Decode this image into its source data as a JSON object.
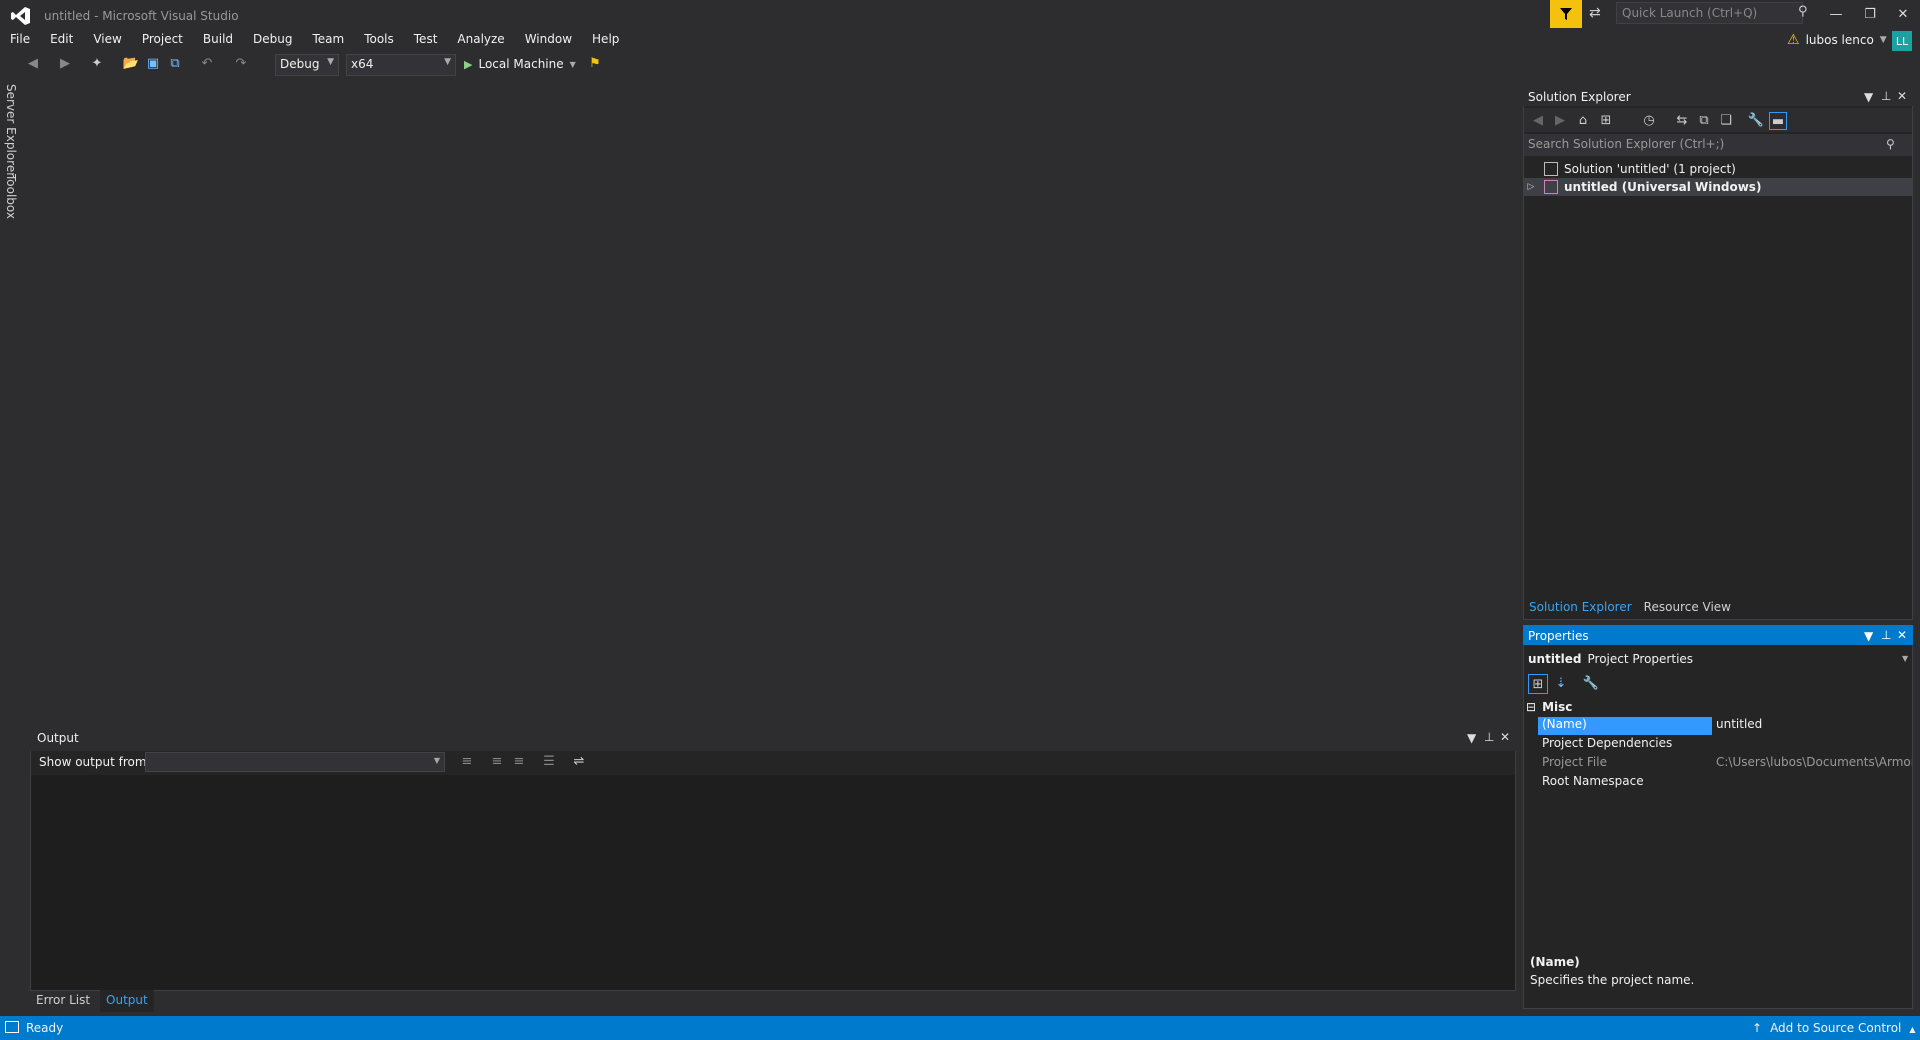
{
  "app": {
    "title": "untitled - Microsoft Visual Studio"
  },
  "quick_launch": {
    "placeholder": "Quick Launch (Ctrl+Q)"
  },
  "account": {
    "name": "lubos lenco",
    "initials": "LL"
  },
  "menu": [
    "File",
    "Edit",
    "View",
    "Project",
    "Build",
    "Debug",
    "Team",
    "Tools",
    "Test",
    "Analyze",
    "Window",
    "Help"
  ],
  "toolbar": {
    "configuration": "Debug",
    "platform": "x64",
    "run_target": "Local Machine"
  },
  "left_rail": {
    "server_explorer": "Server Explorer",
    "toolbox": "Toolbox"
  },
  "output": {
    "title": "Output",
    "show_output_from": "Show output from:",
    "tabs": [
      "Error List",
      "Output"
    ]
  },
  "solution_explorer": {
    "title": "Solution Explorer",
    "search_placeholder": "Search Solution Explorer (Ctrl+;)",
    "solution_label": "Solution 'untitled' (1 project)",
    "project_label": "untitled (Universal Windows)",
    "tabs": [
      "Solution Explorer",
      "Resource View"
    ]
  },
  "properties": {
    "title": "Properties",
    "object_name": "untitled",
    "object_type": "Project Properties",
    "category": "Misc",
    "rows": [
      {
        "name": "(Name)",
        "value": "untitled"
      },
      {
        "name": "Project Dependencies",
        "value": ""
      },
      {
        "name": "Project File",
        "value": "C:\\Users\\lubos\\Documents\\Armory\\"
      },
      {
        "name": "Root Namespace",
        "value": ""
      }
    ],
    "desc_name": "(Name)",
    "desc_text": "Specifies the project name."
  },
  "status": {
    "text": "Ready",
    "source_control": "Add to Source Control"
  },
  "colors": {
    "accent": "#007acc",
    "filter": "#f4c20d",
    "avatar": "#1ba1a0"
  }
}
